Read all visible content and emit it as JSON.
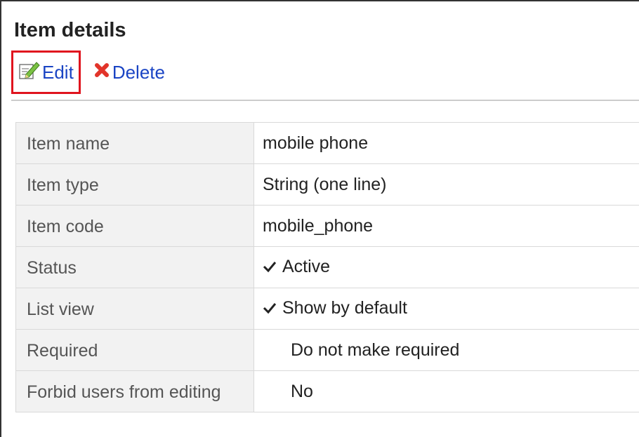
{
  "page": {
    "title": "Item details"
  },
  "toolbar": {
    "edit_label": "Edit",
    "delete_label": "Delete",
    "edit_icon": "edit-icon",
    "delete_icon": "delete-x-icon",
    "link_color": "#1a44c4",
    "highlight_color": "#e0141e"
  },
  "details": {
    "rows": [
      {
        "label": "Item name",
        "value": "mobile phone"
      },
      {
        "label": "Item type",
        "value": "String (one line)"
      },
      {
        "label": "Item code",
        "value": "mobile_phone"
      },
      {
        "label": "Status",
        "value": "Active",
        "icon": "checkmark-icon"
      },
      {
        "label": "List view",
        "value": "Show by default",
        "icon": "checkmark-icon"
      },
      {
        "label": "Required",
        "value": "Do not make required"
      },
      {
        "label": "Forbid users from editing",
        "value": "No"
      }
    ]
  }
}
